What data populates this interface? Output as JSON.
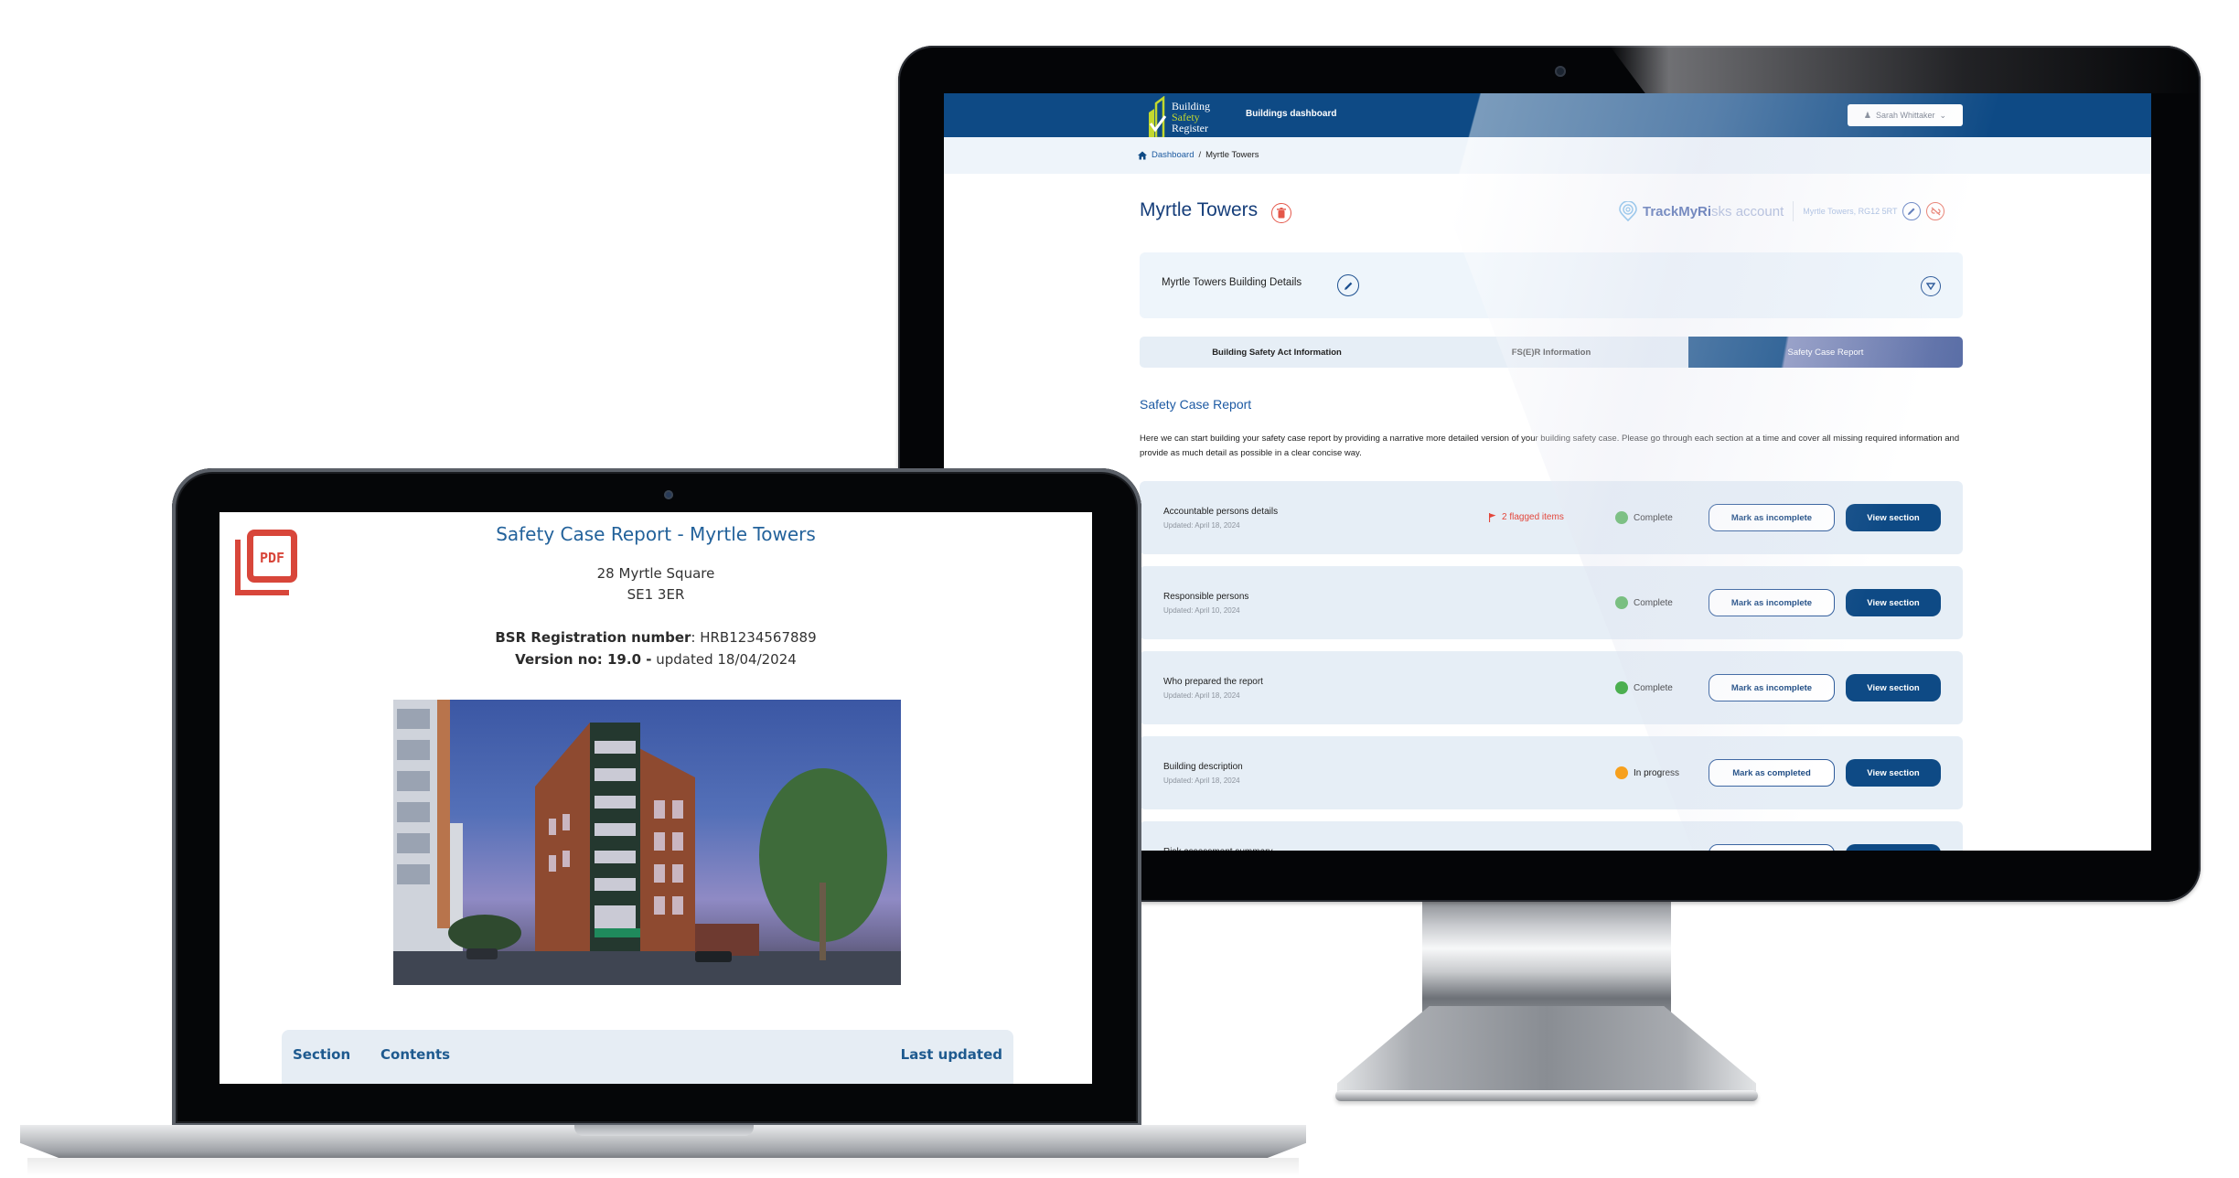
{
  "colors": {
    "brand_blue": "#0e4a85",
    "brand_green": "#c2d82e",
    "status_complete": "#4caf50",
    "status_in_progress": "#f7a01d",
    "flag_red": "#e3463b",
    "pdf_red": "#d8463a"
  },
  "monitor": {
    "header": {
      "logo": {
        "line1": "Building",
        "line2": "Safety",
        "line3": "Register"
      },
      "nav_label": "Buildings dashboard",
      "user": {
        "icon": "user-icon",
        "name": "Sarah Whittaker",
        "caret": "chevron-down-icon"
      }
    },
    "breadcrumb": {
      "home_icon": "home-icon",
      "items": [
        {
          "label": "Dashboard"
        },
        {
          "label": "Myrtle Towers"
        }
      ],
      "separator": "/"
    },
    "page": {
      "title": "Myrtle Towers",
      "delete_icon": "trash-icon",
      "tmr": {
        "icon": "location-pin-icon",
        "label_strong": "TrackMyRi",
        "label_faded": "sks account",
        "address": "Myrtle Towers, RG12 5RT",
        "edit_icon": "pencil-icon",
        "unlink_icon": "unlink-icon"
      }
    },
    "details": {
      "title": "Myrtle Towers Building Details",
      "edit_icon": "pencil-icon",
      "expand_icon": "chevron-down-circle-icon"
    },
    "tabs": [
      {
        "label": "Building Safety Act Information",
        "active": false
      },
      {
        "label": "FS(E)R Information",
        "active": false
      },
      {
        "label": "Safety Case Report",
        "active": true
      }
    ],
    "section": {
      "heading": "Safety Case Report",
      "description": "Here we can start building your safety case report by providing a narrative more detailed version of your building safety case. Please go through each section at a time and cover all missing required information and provide as much detail as possible in a clear concise way."
    },
    "rows": [
      {
        "title": "Accountable persons details",
        "updated": "Updated: April 18, 2024",
        "flag": "2 flagged items",
        "status": "Complete",
        "status_key": "complete",
        "toggle_label": "Mark as incomplete",
        "view_label": "View section"
      },
      {
        "title": "Responsible persons",
        "updated": "Updated: April 10, 2024",
        "flag": null,
        "status": "Complete",
        "status_key": "complete",
        "toggle_label": "Mark as incomplete",
        "view_label": "View section"
      },
      {
        "title": "Who prepared the report",
        "updated": "Updated: April 18, 2024",
        "flag": null,
        "status": "Complete",
        "status_key": "complete",
        "toggle_label": "Mark as incomplete",
        "view_label": "View section"
      },
      {
        "title": "Building description",
        "updated": "Updated: April 18, 2024",
        "flag": null,
        "status": "In progress",
        "status_key": "in_progress",
        "toggle_label": "Mark as completed",
        "view_label": "View section"
      },
      {
        "title": "Risk assessment summary",
        "updated": "",
        "flag": null,
        "status": "",
        "status_key": "in_progress",
        "toggle_label": "",
        "view_label": ""
      }
    ]
  },
  "laptop": {
    "pdf_icon": "pdf-icon",
    "pdf_icon_label": "PDF",
    "title": "Safety Case Report - Myrtle Towers",
    "address_line1": "28 Myrtle Square",
    "address_line2": "SE1 3ER",
    "bsr_label": "BSR Registration number",
    "bsr_value": ": HRB1234567889",
    "version_label": "Version no: 19.0 -",
    "version_value": " updated 18/04/2024",
    "photo_alt": "building-photo",
    "table_headers": {
      "section": "Section",
      "contents": "Contents",
      "last_updated": "Last updated"
    }
  }
}
